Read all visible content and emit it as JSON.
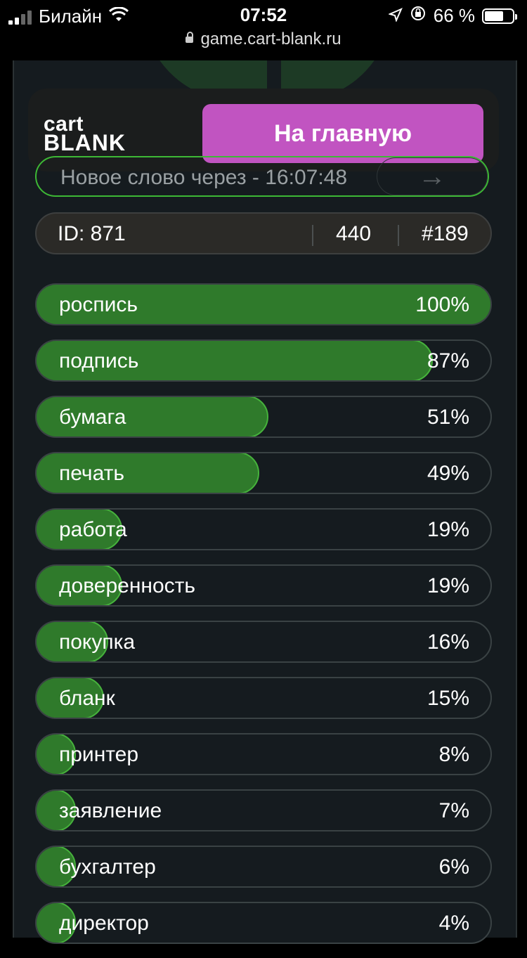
{
  "status_bar": {
    "carrier": "Билайн",
    "time": "07:52",
    "battery": "66 %",
    "url": "game.cart-blank.ru"
  },
  "header": {
    "logo_line1": "cart",
    "logo_line2": "BLANK",
    "home_button": "На главную"
  },
  "timer": {
    "text": "Новое слово через - 16:07:48",
    "arrow": "→"
  },
  "info": {
    "id": "ID: 871",
    "count": "440",
    "number": "#189"
  },
  "answers": [
    {
      "word": "роспись",
      "percent": "100%",
      "value": 100
    },
    {
      "word": "подпись",
      "percent": "87%",
      "value": 87
    },
    {
      "word": "бумага",
      "percent": "51%",
      "value": 51
    },
    {
      "word": "печать",
      "percent": "49%",
      "value": 49
    },
    {
      "word": "работа",
      "percent": "19%",
      "value": 19
    },
    {
      "word": "доверенность",
      "percent": "19%",
      "value": 19
    },
    {
      "word": "покупка",
      "percent": "16%",
      "value": 16
    },
    {
      "word": "бланк",
      "percent": "15%",
      "value": 15
    },
    {
      "word": "принтер",
      "percent": "8%",
      "value": 8
    },
    {
      "word": "заявление",
      "percent": "7%",
      "value": 7
    },
    {
      "word": "бухгалтер",
      "percent": "6%",
      "value": 6
    },
    {
      "word": "директор",
      "percent": "4%",
      "value": 4
    }
  ],
  "colors": {
    "accent": "#c154c1",
    "bar_fill": "#2f7a2b",
    "bar_border": "#46b23c",
    "background": "#151b1f"
  }
}
